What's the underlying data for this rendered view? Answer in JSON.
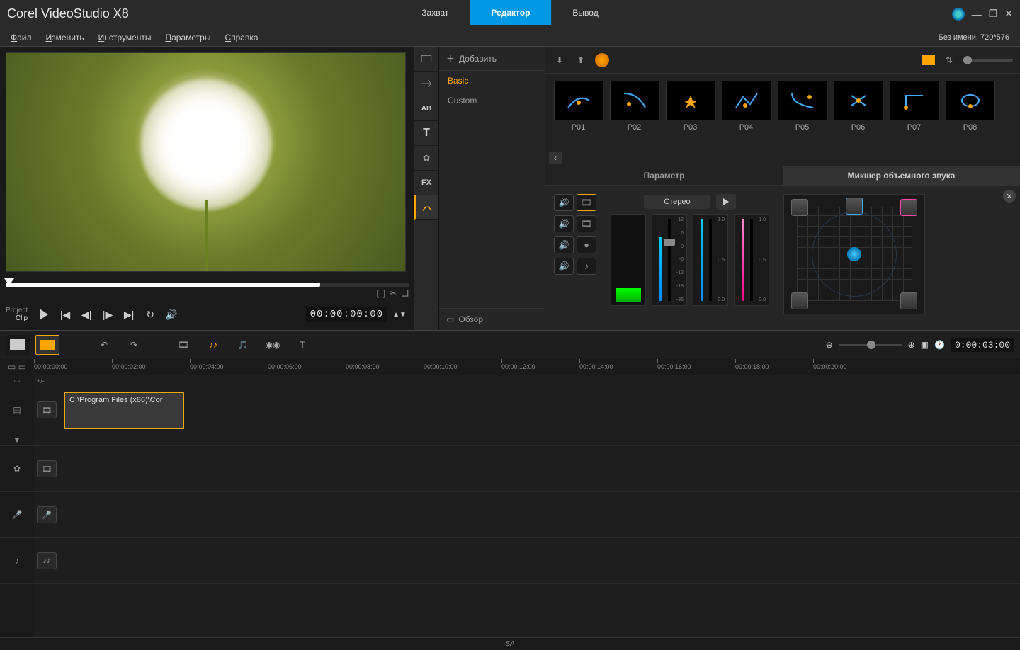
{
  "app": {
    "title": "Corel VideoStudio X8"
  },
  "workflow": {
    "capture": "Захват",
    "editor": "Редактор",
    "output": "Вывод"
  },
  "menu": {
    "file": "Файл",
    "edit": "Изменить",
    "tools": "Инструменты",
    "params": "Параметры",
    "help": "Справка"
  },
  "document": {
    "info": "Без имени, 720*576"
  },
  "preview": {
    "project_label": "Project",
    "clip_label": "Clip",
    "timecode": "00:00:00:00"
  },
  "library": {
    "add": "Добавить",
    "categories": {
      "basic": "Basic",
      "custom": "Custom"
    },
    "review": "Обзор",
    "presets": [
      "P01",
      "P02",
      "P03",
      "P04",
      "P05",
      "P06",
      "P07",
      "P08"
    ]
  },
  "options_tabs": {
    "param": "Параметр",
    "mixer": "Микшер объемного звука"
  },
  "mixer": {
    "stereo": "Стерео",
    "db_scale": [
      "12",
      "6",
      "0",
      "-6",
      "-12",
      "-18",
      "-36"
    ],
    "pan_scale": [
      "1.0",
      "0.5",
      "0.0"
    ]
  },
  "timeline": {
    "duration": "0:00:03:00",
    "ruler": [
      "00:00:00:00",
      "00:00:02:00",
      "00:00:04:00",
      "00:00:06:00",
      "00:00:08:00",
      "00:00:10:00",
      "00:00:12:00",
      "00:00:14:00",
      "00:00:16:00",
      "00:00:18:00",
      "00:00:20:00"
    ],
    "tiny": "+/-=",
    "clip_label": "C:\\Program Files (x86)\\Cor"
  },
  "status": {
    "text": "SA"
  }
}
